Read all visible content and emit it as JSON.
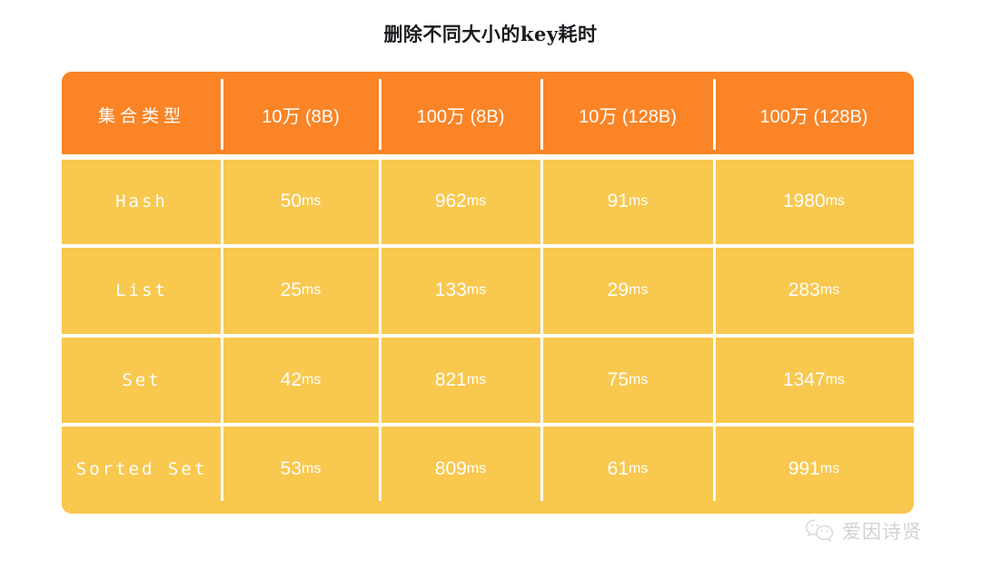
{
  "title": "删除不同大小的key耗时",
  "table": {
    "columns": [
      "集合类型",
      "10万 (8B)",
      "100万 (8B)",
      "10万 (128B)",
      "100万 (128B)"
    ],
    "rows": [
      {
        "label": "Hash",
        "values": [
          "50ms",
          "962ms",
          "91ms",
          "1980ms"
        ]
      },
      {
        "label": "List",
        "values": [
          "25ms",
          "133ms",
          "29ms",
          "283ms"
        ]
      },
      {
        "label": "Set",
        "values": [
          "42ms",
          "821ms",
          "75ms",
          "1347ms"
        ]
      },
      {
        "label": "Sorted Set",
        "values": [
          "53ms",
          "809ms",
          "61ms",
          "991ms"
        ]
      }
    ]
  },
  "watermark": {
    "icon": "wechat-icon",
    "text": "爱因诗贤"
  },
  "colors": {
    "header_background": "#FA8426",
    "body_background": "#F8C84F",
    "cell_text": "#FFFFFF",
    "title_text": "#1B1B20",
    "divider": "#FFFFFF",
    "watermark_text": "#D2D2D2",
    "page_background": "#FFFFFF"
  },
  "chart_data": {
    "type": "table",
    "title": "删除不同大小的key耗时",
    "unit": "ms",
    "categories": [
      "Hash",
      "List",
      "Set",
      "Sorted Set"
    ],
    "series": [
      {
        "name": "10万 (8B)",
        "values": [
          50,
          25,
          42,
          53
        ]
      },
      {
        "name": "100万 (8B)",
        "values": [
          962,
          133,
          821,
          809
        ]
      },
      {
        "name": "10万 (128B)",
        "values": [
          91,
          29,
          75,
          61
        ]
      },
      {
        "name": "100万 (128B)",
        "values": [
          1980,
          283,
          1347,
          991
        ]
      }
    ]
  }
}
